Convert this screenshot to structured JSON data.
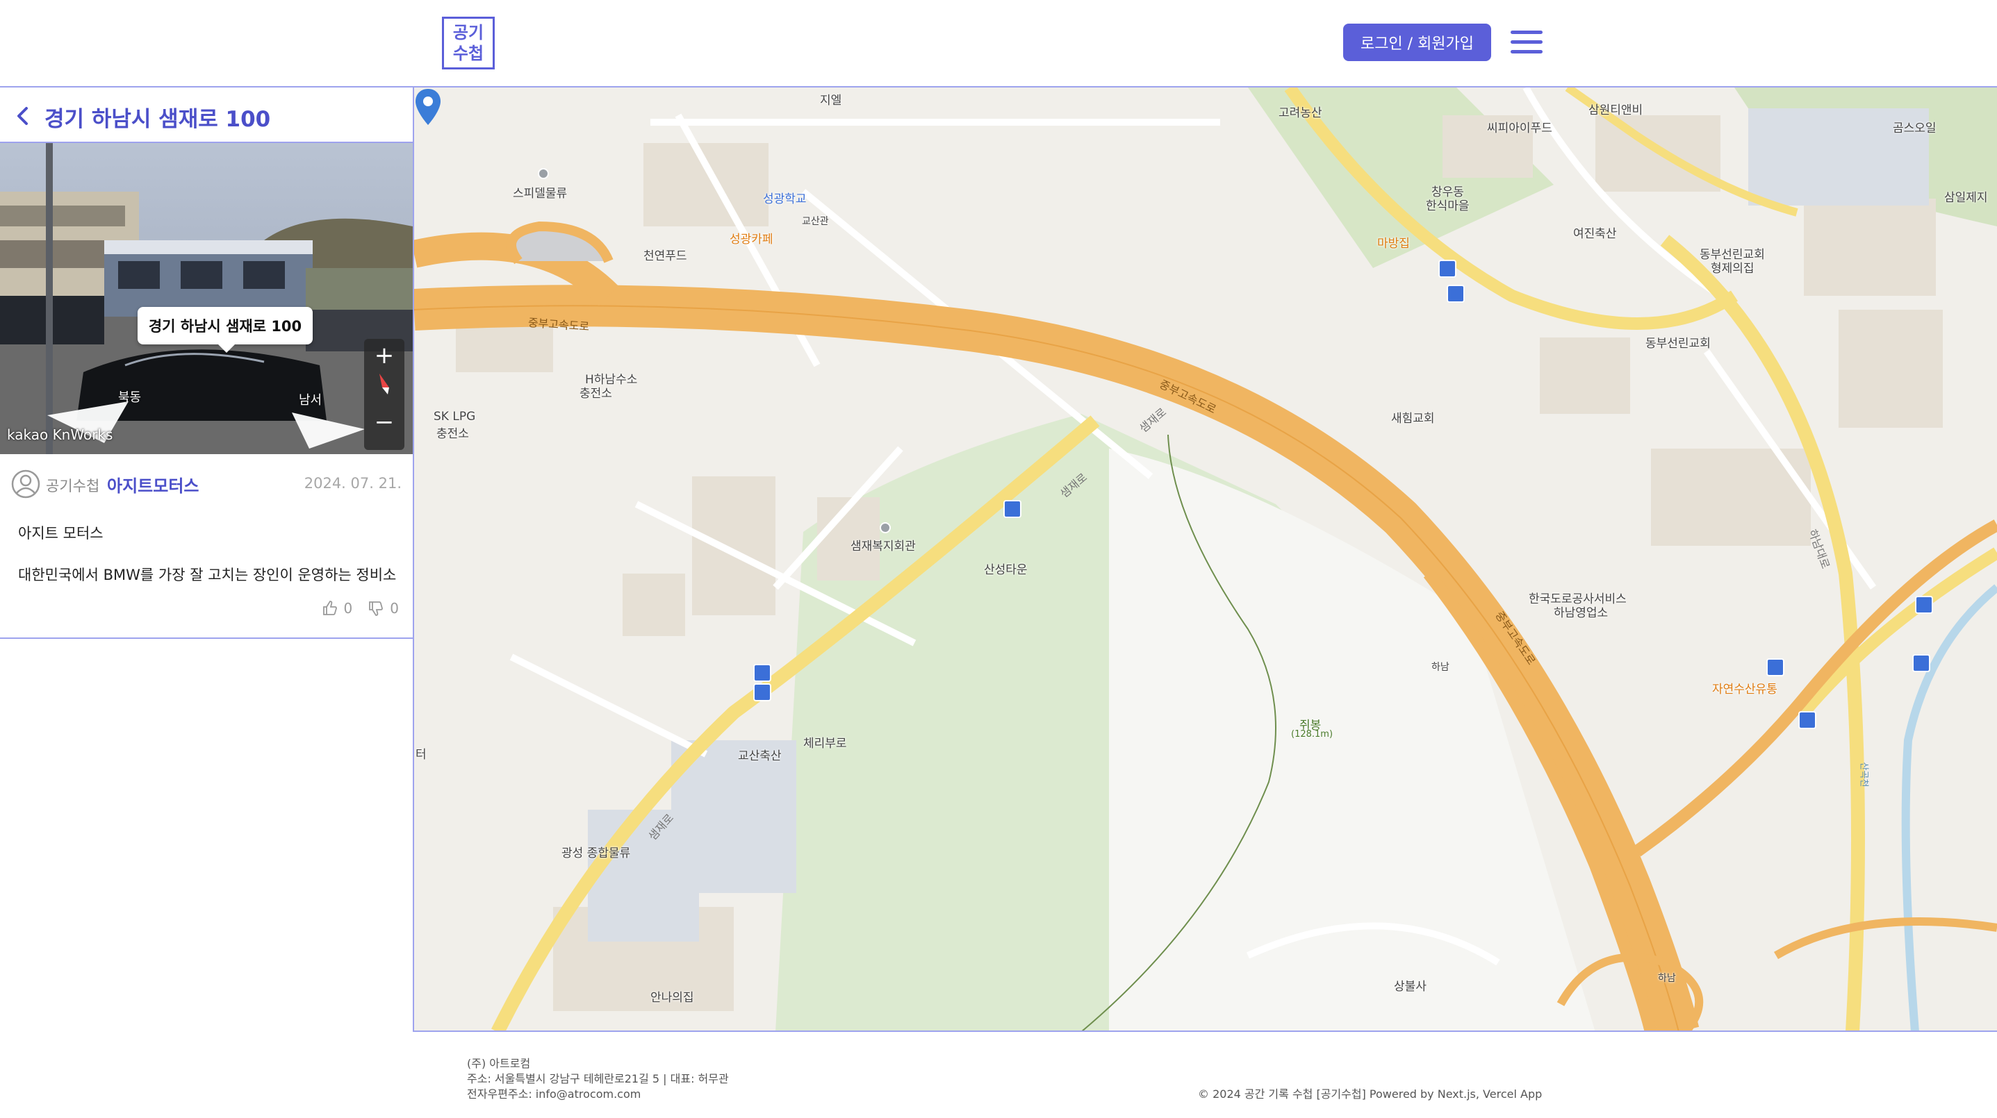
{
  "header": {
    "logo_line1": "공기",
    "logo_line2": "수첩",
    "login_label": "로그인 / 회원가입",
    "menu_icon": "hamburger-menu-icon",
    "accent_color": "#5b5fd9"
  },
  "sidebar": {
    "title": "경기 하남시 샘재로 100",
    "roadview": {
      "label": "경기 하남시 샘재로 100",
      "zoom_in": "+",
      "zoom_out": "−",
      "dir_left": "북동",
      "dir_right": "남서",
      "brand": "kakao KnWorks"
    },
    "post": {
      "category": "공기수첩",
      "author": "아지트모터스",
      "date": "2024. 07. 21.",
      "title": "아지트 모터스",
      "body": "대한민국에서 BMW를 가장 잘 고치는 장인이 운영하는 정비소",
      "likes": "0",
      "dislikes": "0"
    }
  },
  "map": {
    "pois": [
      {
        "name": "지엘"
      },
      {
        "name": "스피델물류"
      },
      {
        "name": "성광학교"
      },
      {
        "name": "교산관"
      },
      {
        "name": "성광카페"
      },
      {
        "name": "천연푸드"
      },
      {
        "name": "H하남수소"
      },
      {
        "name": "충전소"
      },
      {
        "name": "SK LPG"
      },
      {
        "name": "충전소"
      },
      {
        "name": "샘재복지회관"
      },
      {
        "name": "산성타운"
      },
      {
        "name": "체리부로"
      },
      {
        "name": "교산축산"
      },
      {
        "name": "광성 종합물류"
      },
      {
        "name": "안나의집"
      },
      {
        "name": "고려농산"
      },
      {
        "name": "씨피아이푸드"
      },
      {
        "name": "삼원티앤비"
      },
      {
        "name": "곰스오일"
      },
      {
        "name": "삼일제지"
      },
      {
        "name": "창우동"
      },
      {
        "name": "한식마을"
      },
      {
        "name": "마방집"
      },
      {
        "name": "여진축산"
      },
      {
        "name": "동부선린교회"
      },
      {
        "name": "형제의집"
      },
      {
        "name": "동부선린교회"
      },
      {
        "name": "새힘교회"
      },
      {
        "name": "한국도로공사서비스"
      },
      {
        "name": "하남영업소"
      },
      {
        "name": "하남"
      },
      {
        "name": "자연수산유통"
      },
      {
        "name": "쥐봉"
      },
      {
        "name": "(128.1m)"
      },
      {
        "name": "상불사"
      },
      {
        "name": "하남"
      },
      {
        "name": "터"
      }
    ],
    "road_labels": [
      "중부고속도로",
      "중부고속도로",
      "중부고속도로",
      "샘재로",
      "샘재로",
      "샘재로",
      "하남대로",
      "산곡천"
    ],
    "colors": {
      "highway": "#f0b561",
      "major_road": "#f6de7e",
      "park": "#c9deb0",
      "building": "#e4dfd6"
    }
  },
  "footer": {
    "company": "(주) 아트로컴",
    "address": "주소: 서울특별시 강남구 테헤란로21길 5 | 대표: 허무관",
    "email": "전자우편주소: info@atrocom.com",
    "copyright": "© 2024 공간 기록 수첩 [공기수첩] Powered by Next.js, Vercel App"
  }
}
